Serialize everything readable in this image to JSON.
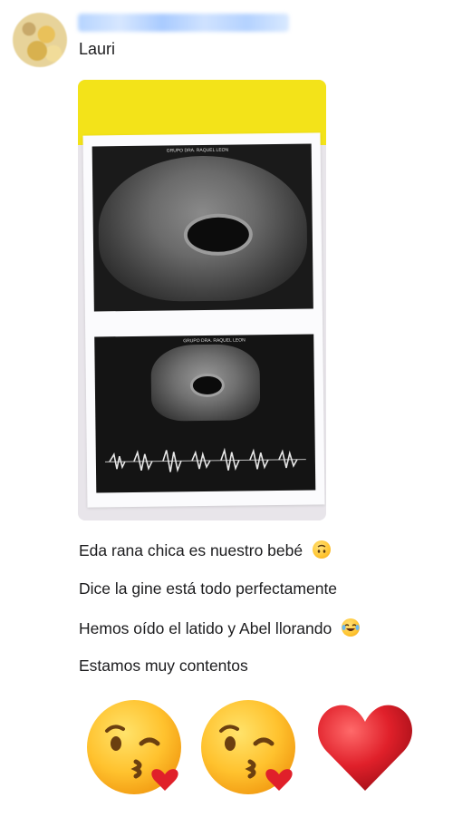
{
  "sender": {
    "name": "Lauri"
  },
  "photo": {
    "scan_top": {
      "header": "GRUPO DRA. RAQUEL LEON"
    },
    "scan_bottom": {
      "header": "GRUPO DRA. RAQUEL LEON"
    }
  },
  "messages": [
    {
      "text": "Eda rana chica es nuestro bebé",
      "emoji": "upside-down-face"
    },
    {
      "text": "Dice la gine está todo perfectamente",
      "emoji": ""
    },
    {
      "text": "Hemos oído el latido y Abel llorando",
      "emoji": "joy"
    },
    {
      "text": "Estamos muy contentos",
      "emoji": ""
    }
  ],
  "big_emojis": [
    "kissing-heart-face",
    "kissing-heart-face",
    "red-heart"
  ],
  "colors": {
    "sender_blur": "#b6d4ff",
    "photo_background": "#f3e319",
    "heart": "#e0202a"
  }
}
